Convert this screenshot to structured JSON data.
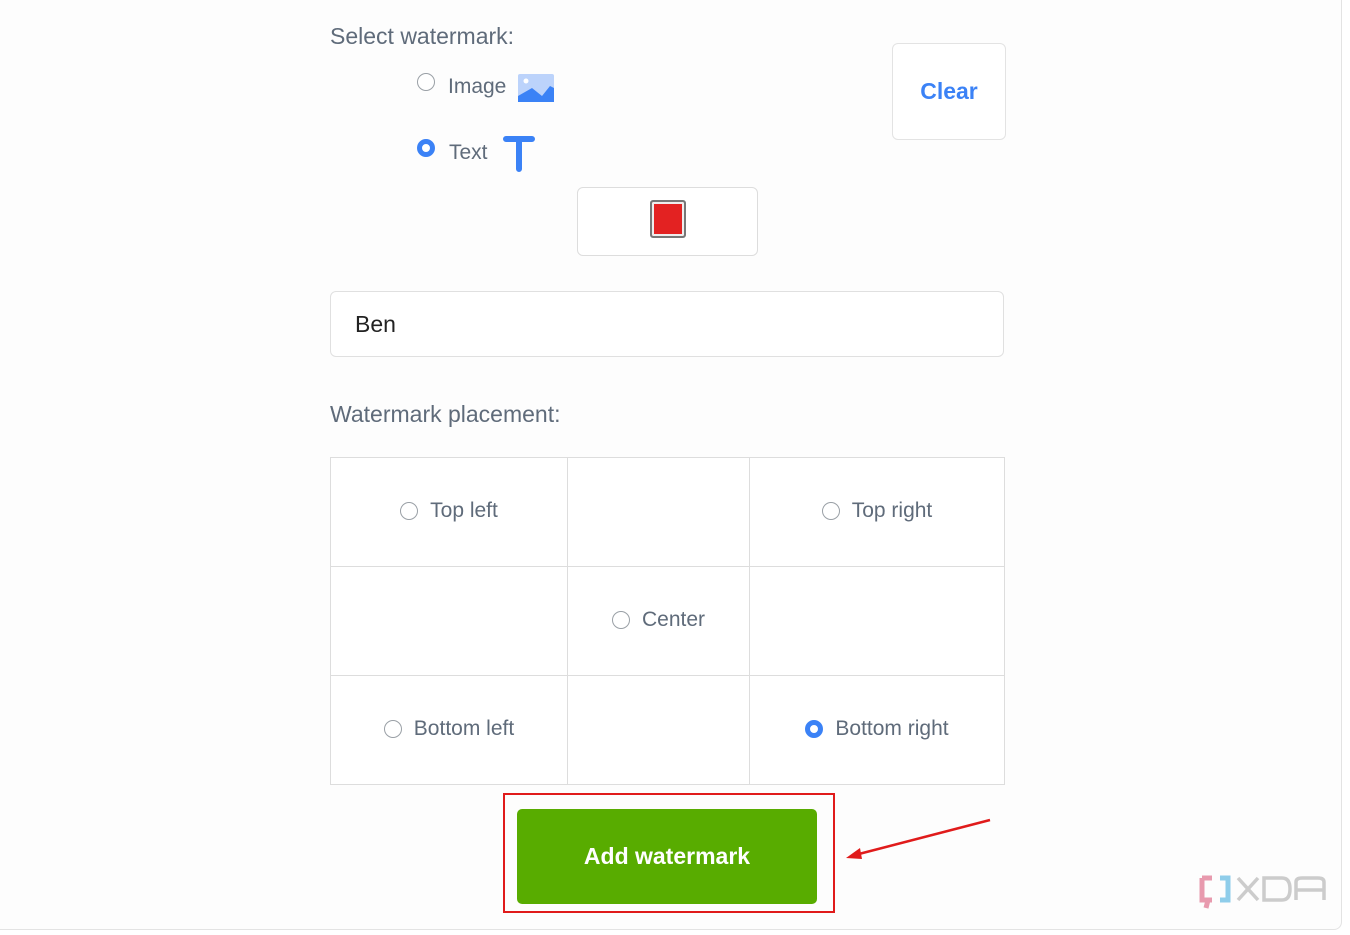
{
  "select_watermark": {
    "label": "Select watermark:",
    "options": [
      {
        "label": "Image",
        "icon": "image-icon",
        "selected": false
      },
      {
        "label": "Text",
        "icon": "text-icon",
        "selected": true
      }
    ],
    "clear_label": "Clear",
    "color": "#e32222"
  },
  "text_input": {
    "value": "Ben"
  },
  "placement": {
    "label": "Watermark placement:",
    "top_left": "Top left",
    "top_right": "Top right",
    "center": "Center",
    "bottom_left": "Bottom left",
    "bottom_right": "Bottom right",
    "selected": "Bottom right"
  },
  "add_button": {
    "label": "Add watermark"
  },
  "colors": {
    "accent": "#3b82f6",
    "button": "#58ac00",
    "highlight": "#e01b1b"
  },
  "watermark_logo": "XDA"
}
